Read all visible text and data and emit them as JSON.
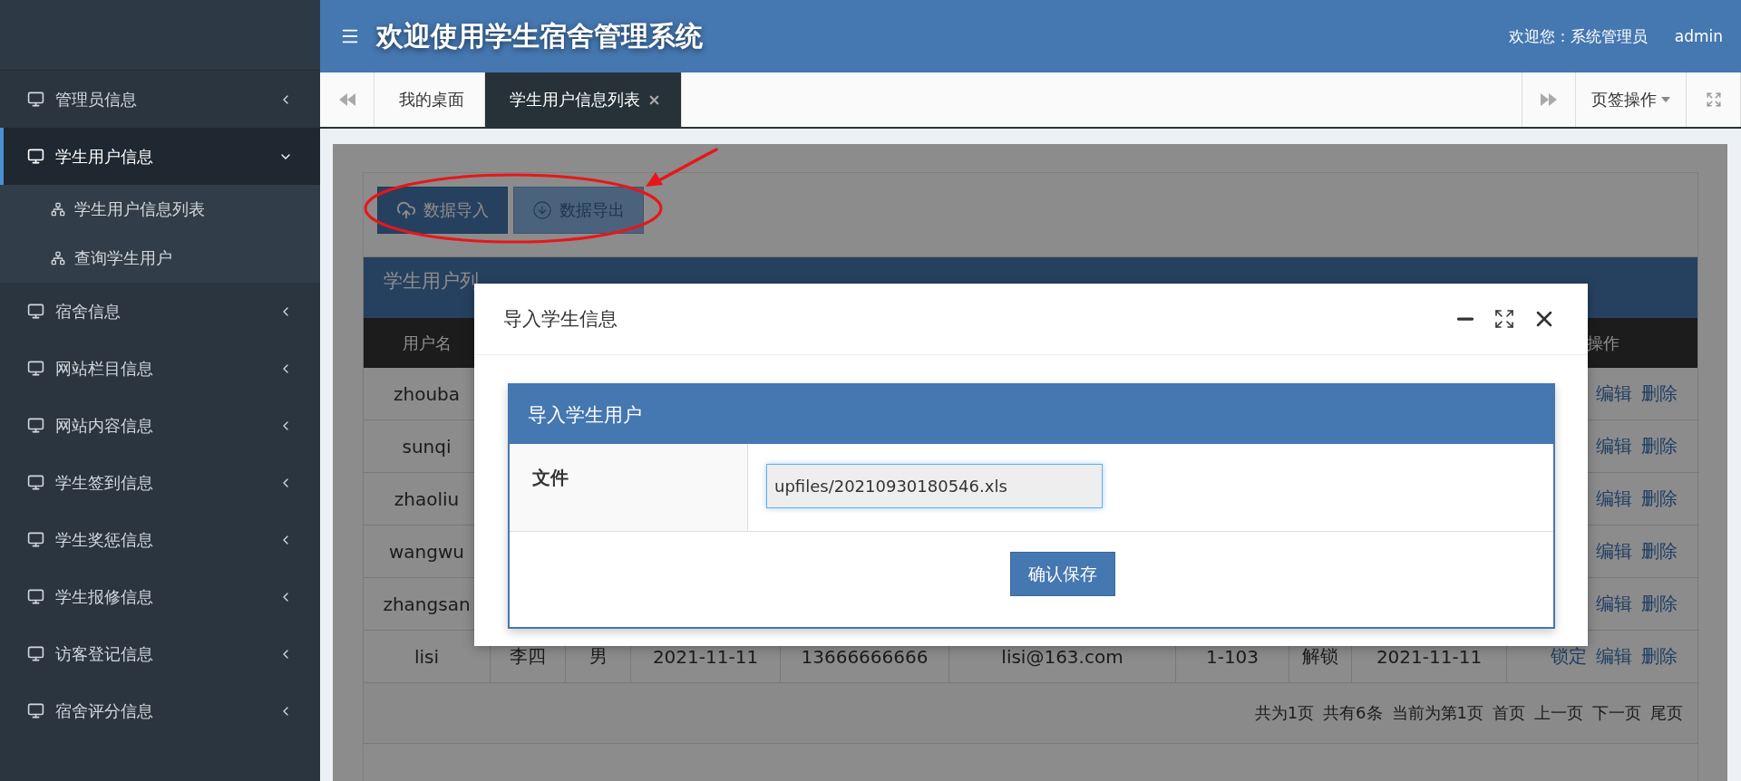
{
  "header": {
    "title": "欢迎使用学生宿舍管理系统",
    "welcome": "欢迎您：系统管理员",
    "user": "admin"
  },
  "sidebar": {
    "items": [
      {
        "label": "管理员信息",
        "selected": false,
        "expanded": false
      },
      {
        "label": "学生用户信息",
        "selected": true,
        "expanded": true,
        "children": [
          {
            "label": "学生用户信息列表"
          },
          {
            "label": "查询学生用户"
          }
        ]
      },
      {
        "label": "宿舍信息",
        "selected": false,
        "expanded": false
      },
      {
        "label": "网站栏目信息",
        "selected": false,
        "expanded": false
      },
      {
        "label": "网站内容信息",
        "selected": false,
        "expanded": false
      },
      {
        "label": "学生签到信息",
        "selected": false,
        "expanded": false
      },
      {
        "label": "学生奖惩信息",
        "selected": false,
        "expanded": false
      },
      {
        "label": "学生报修信息",
        "selected": false,
        "expanded": false
      },
      {
        "label": "访客登记信息",
        "selected": false,
        "expanded": false
      },
      {
        "label": "宿舍评分信息",
        "selected": false,
        "expanded": false
      }
    ]
  },
  "tabs": {
    "items": [
      {
        "label": "我的桌面",
        "selected": false,
        "closable": false
      },
      {
        "label": "学生用户信息列表",
        "selected": true,
        "closable": true
      }
    ],
    "menu_label": "页签操作"
  },
  "toolbar": {
    "buttons": [
      {
        "label": "数据导入",
        "kind": "import"
      },
      {
        "label": "数据导出",
        "kind": "export"
      }
    ]
  },
  "panel": {
    "title": "学生用户列",
    "columns": [
      "用户名",
      "操作"
    ],
    "rows": [
      {
        "username": "zhouba",
        "actions": [
          "编辑",
          "删除"
        ]
      },
      {
        "username": "sunqi",
        "actions": [
          "编辑",
          "删除"
        ]
      },
      {
        "username": "zhaoliu",
        "actions": [
          "编辑",
          "删除"
        ]
      },
      {
        "username": "wangwu",
        "actions": [
          "编辑",
          "删除"
        ]
      },
      {
        "username": "zhangsan",
        "actions": [
          "编辑",
          "删除"
        ]
      },
      {
        "username": "lisi",
        "cells": [
          "李四",
          "男",
          "2021-11-11",
          "13666666666",
          "lisi@163.com",
          "1-103",
          "解锁",
          "2021-11-11"
        ],
        "actions": [
          "锁定",
          "编辑",
          "删除"
        ]
      }
    ],
    "pagination": [
      "共为1页",
      "共有6条",
      "当前为第1页",
      "首页",
      "上一页",
      "下一页",
      "尾页"
    ]
  },
  "modal": {
    "title": "导入学生信息",
    "form_title": "导入学生用户",
    "fields": [
      {
        "label": "文件",
        "value": "upfiles/20210930180546.xls"
      }
    ],
    "submit": "确认保存"
  }
}
